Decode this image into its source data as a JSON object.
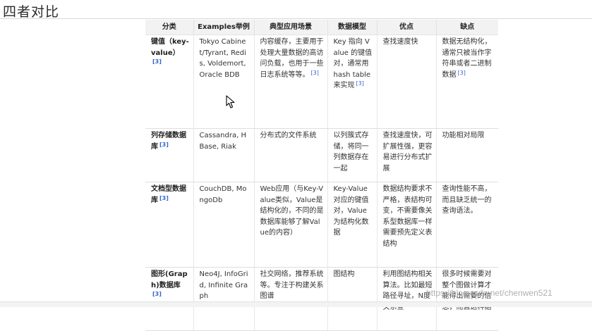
{
  "heading": "四者对比",
  "table": {
    "headers": [
      "分类",
      "Examples举例",
      "典型应用场景",
      "数据模型",
      "优点",
      "缺点"
    ],
    "rows": [
      {
        "category": "键值（key-value）",
        "examples": "Tokyo Cabinet/Tyrant, Redis, Voldemort, Oracle BDB",
        "scenarios": "内容缓存，主要用于处理大量数据的高访问负载，也用于一些日志系统等等。",
        "model": "Key 指向 Value 的键值对，通常用hash table来实现",
        "pros": "查找速度快",
        "cons": "数据无结构化，通常只被当作字符串或者二进制数据",
        "refs": [
          "[3]",
          "",
          "[3]",
          "[3]",
          "",
          "[3]"
        ]
      },
      {
        "category": "列存储数据库",
        "examples": "Cassandra, HBase, Riak",
        "scenarios": "分布式的文件系统",
        "model": "以列簇式存储，将同一列数据存在一起",
        "pros": "查找速度快，可扩展性强，更容易进行分布式扩展",
        "cons": "功能相对局限",
        "refs": [
          "[3]",
          "",
          "",
          "",
          "",
          ""
        ]
      },
      {
        "category": "文档型数据库",
        "examples": "CouchDB, MongoDb",
        "scenarios": "Web应用（与Key-Value类似，Value是结构化的，不同的是数据库能够了解Value的内容）",
        "model": "Key-Value对应的键值对，Value为结构化数据",
        "pros": "数据结构要求不严格，表结构可变，不需要像关系型数据库一样需要预先定义表结构",
        "cons": "查询性能不高，而且缺乏统一的查询语法。",
        "refs": [
          "[3]",
          "",
          "",
          "",
          "",
          ""
        ]
      },
      {
        "category": "图形(Graph)数据库",
        "examples": "Neo4J, InfoGrid, Infinite Graph",
        "scenarios": "社交网络，推荐系统等。专注于构建关系图谱",
        "model": "图结构",
        "pros": "利用图结构相关算法。比如最短路径寻址，N度关系查",
        "cons": "很多时候需要对整个图做计算才能得出需要的信息，而且这种结",
        "refs": [
          "[3]",
          "",
          "",
          "",
          "",
          ""
        ]
      }
    ]
  },
  "watermark": "https://blog.csdn.net/chenwen521"
}
